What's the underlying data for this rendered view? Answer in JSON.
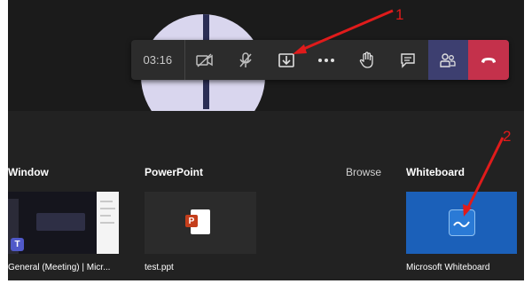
{
  "toolbar": {
    "timer": "03:16",
    "buttons": [
      {
        "name": "camera-off-button",
        "icon": "camera-off-icon"
      },
      {
        "name": "mic-off-button",
        "icon": "mic-off-icon"
      },
      {
        "name": "share-tray-button",
        "icon": "share-tray-icon"
      },
      {
        "name": "more-actions-button",
        "icon": "ellipsis-icon"
      },
      {
        "name": "raise-hand-button",
        "icon": "hand-icon"
      },
      {
        "name": "chat-button",
        "icon": "chat-icon"
      },
      {
        "name": "participants-button",
        "icon": "people-icon"
      },
      {
        "name": "leave-button",
        "icon": "hang-up-icon"
      }
    ],
    "colors": {
      "bar": "#2c2c2c",
      "participants": "#3d3f70",
      "leave": "#c4314b"
    }
  },
  "share": {
    "window_label": "Window",
    "window_caption": "General (Meeting) | Micr...",
    "powerpoint_label": "PowerPoint",
    "powerpoint_caption": "test.ppt",
    "browse_label": "Browse",
    "whiteboard_label": "Whiteboard",
    "whiteboard_caption": "Microsoft Whiteboard"
  },
  "annotations": {
    "first": "1",
    "second": "2",
    "color": "#e01b1b"
  },
  "thumb_text": {
    "teams_letter": "T",
    "ppt_letter": "P"
  }
}
